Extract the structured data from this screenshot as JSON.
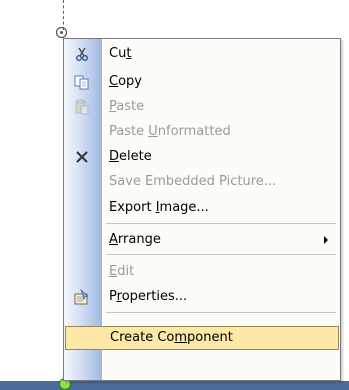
{
  "menu": {
    "items": [
      {
        "pre": "Cu",
        "ul": "t",
        "post": "",
        "enabled": true,
        "icon": "scissors-icon"
      },
      {
        "pre": "",
        "ul": "C",
        "post": "opy",
        "enabled": true,
        "icon": "copy-icon"
      },
      {
        "pre": "",
        "ul": "P",
        "post": "aste",
        "enabled": false,
        "icon": "paste-icon"
      },
      {
        "pre": "Paste ",
        "ul": "U",
        "post": "nformatted",
        "enabled": false,
        "icon": ""
      },
      {
        "pre": "",
        "ul": "D",
        "post": "elete",
        "enabled": true,
        "icon": "delete-x-icon"
      },
      {
        "pre": "Save Embedded Picture...",
        "ul": "",
        "post": "",
        "enabled": false,
        "icon": ""
      },
      {
        "pre": "Export ",
        "ul": "I",
        "post": "mage...",
        "enabled": true,
        "icon": ""
      },
      {
        "pre": "",
        "ul": "A",
        "post": "rrange",
        "enabled": true,
        "icon": "",
        "submenu": true
      },
      {
        "pre": "",
        "ul": "E",
        "post": "dit",
        "enabled": false,
        "icon": ""
      },
      {
        "pre": "P",
        "ul": "r",
        "post": "operties...",
        "enabled": true,
        "icon": "properties-icon"
      },
      {
        "pre": "Create Co",
        "ul": "m",
        "post": "ponent",
        "enabled": true,
        "icon": "",
        "highlighted": true
      }
    ]
  },
  "colors": {
    "highlight_fill": "#fde8a8",
    "gutter_edge": "#9eb7e2",
    "status_bar": "#4a6c9b",
    "handle_green": "#8ee04b"
  }
}
